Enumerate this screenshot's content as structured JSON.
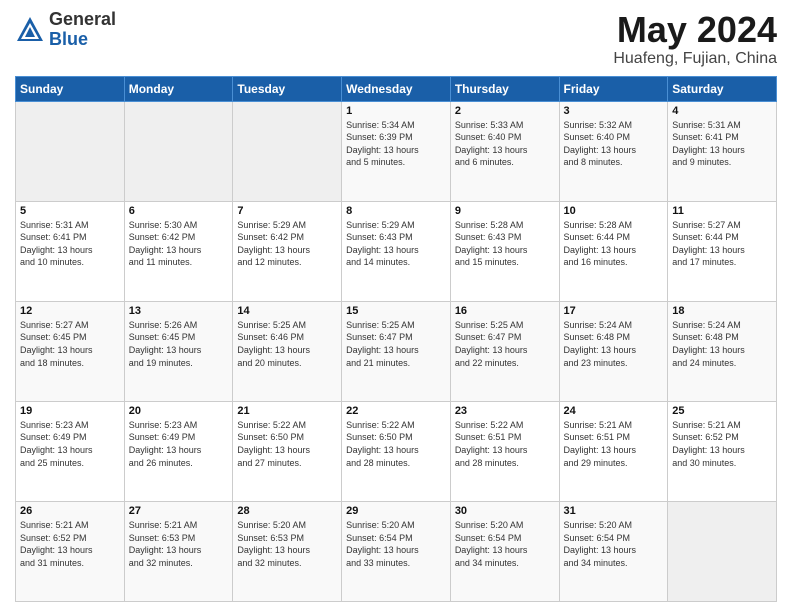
{
  "header": {
    "logo_general": "General",
    "logo_blue": "Blue",
    "title": "May 2024",
    "subtitle": "Huafeng, Fujian, China"
  },
  "weekdays": [
    "Sunday",
    "Monday",
    "Tuesday",
    "Wednesday",
    "Thursday",
    "Friday",
    "Saturday"
  ],
  "weeks": [
    [
      {
        "day": "",
        "info": ""
      },
      {
        "day": "",
        "info": ""
      },
      {
        "day": "",
        "info": ""
      },
      {
        "day": "1",
        "info": "Sunrise: 5:34 AM\nSunset: 6:39 PM\nDaylight: 13 hours\nand 5 minutes."
      },
      {
        "day": "2",
        "info": "Sunrise: 5:33 AM\nSunset: 6:40 PM\nDaylight: 13 hours\nand 6 minutes."
      },
      {
        "day": "3",
        "info": "Sunrise: 5:32 AM\nSunset: 6:40 PM\nDaylight: 13 hours\nand 8 minutes."
      },
      {
        "day": "4",
        "info": "Sunrise: 5:31 AM\nSunset: 6:41 PM\nDaylight: 13 hours\nand 9 minutes."
      }
    ],
    [
      {
        "day": "5",
        "info": "Sunrise: 5:31 AM\nSunset: 6:41 PM\nDaylight: 13 hours\nand 10 minutes."
      },
      {
        "day": "6",
        "info": "Sunrise: 5:30 AM\nSunset: 6:42 PM\nDaylight: 13 hours\nand 11 minutes."
      },
      {
        "day": "7",
        "info": "Sunrise: 5:29 AM\nSunset: 6:42 PM\nDaylight: 13 hours\nand 12 minutes."
      },
      {
        "day": "8",
        "info": "Sunrise: 5:29 AM\nSunset: 6:43 PM\nDaylight: 13 hours\nand 14 minutes."
      },
      {
        "day": "9",
        "info": "Sunrise: 5:28 AM\nSunset: 6:43 PM\nDaylight: 13 hours\nand 15 minutes."
      },
      {
        "day": "10",
        "info": "Sunrise: 5:28 AM\nSunset: 6:44 PM\nDaylight: 13 hours\nand 16 minutes."
      },
      {
        "day": "11",
        "info": "Sunrise: 5:27 AM\nSunset: 6:44 PM\nDaylight: 13 hours\nand 17 minutes."
      }
    ],
    [
      {
        "day": "12",
        "info": "Sunrise: 5:27 AM\nSunset: 6:45 PM\nDaylight: 13 hours\nand 18 minutes."
      },
      {
        "day": "13",
        "info": "Sunrise: 5:26 AM\nSunset: 6:45 PM\nDaylight: 13 hours\nand 19 minutes."
      },
      {
        "day": "14",
        "info": "Sunrise: 5:25 AM\nSunset: 6:46 PM\nDaylight: 13 hours\nand 20 minutes."
      },
      {
        "day": "15",
        "info": "Sunrise: 5:25 AM\nSunset: 6:47 PM\nDaylight: 13 hours\nand 21 minutes."
      },
      {
        "day": "16",
        "info": "Sunrise: 5:25 AM\nSunset: 6:47 PM\nDaylight: 13 hours\nand 22 minutes."
      },
      {
        "day": "17",
        "info": "Sunrise: 5:24 AM\nSunset: 6:48 PM\nDaylight: 13 hours\nand 23 minutes."
      },
      {
        "day": "18",
        "info": "Sunrise: 5:24 AM\nSunset: 6:48 PM\nDaylight: 13 hours\nand 24 minutes."
      }
    ],
    [
      {
        "day": "19",
        "info": "Sunrise: 5:23 AM\nSunset: 6:49 PM\nDaylight: 13 hours\nand 25 minutes."
      },
      {
        "day": "20",
        "info": "Sunrise: 5:23 AM\nSunset: 6:49 PM\nDaylight: 13 hours\nand 26 minutes."
      },
      {
        "day": "21",
        "info": "Sunrise: 5:22 AM\nSunset: 6:50 PM\nDaylight: 13 hours\nand 27 minutes."
      },
      {
        "day": "22",
        "info": "Sunrise: 5:22 AM\nSunset: 6:50 PM\nDaylight: 13 hours\nand 28 minutes."
      },
      {
        "day": "23",
        "info": "Sunrise: 5:22 AM\nSunset: 6:51 PM\nDaylight: 13 hours\nand 28 minutes."
      },
      {
        "day": "24",
        "info": "Sunrise: 5:21 AM\nSunset: 6:51 PM\nDaylight: 13 hours\nand 29 minutes."
      },
      {
        "day": "25",
        "info": "Sunrise: 5:21 AM\nSunset: 6:52 PM\nDaylight: 13 hours\nand 30 minutes."
      }
    ],
    [
      {
        "day": "26",
        "info": "Sunrise: 5:21 AM\nSunset: 6:52 PM\nDaylight: 13 hours\nand 31 minutes."
      },
      {
        "day": "27",
        "info": "Sunrise: 5:21 AM\nSunset: 6:53 PM\nDaylight: 13 hours\nand 32 minutes."
      },
      {
        "day": "28",
        "info": "Sunrise: 5:20 AM\nSunset: 6:53 PM\nDaylight: 13 hours\nand 32 minutes."
      },
      {
        "day": "29",
        "info": "Sunrise: 5:20 AM\nSunset: 6:54 PM\nDaylight: 13 hours\nand 33 minutes."
      },
      {
        "day": "30",
        "info": "Sunrise: 5:20 AM\nSunset: 6:54 PM\nDaylight: 13 hours\nand 34 minutes."
      },
      {
        "day": "31",
        "info": "Sunrise: 5:20 AM\nSunset: 6:54 PM\nDaylight: 13 hours\nand 34 minutes."
      },
      {
        "day": "",
        "info": ""
      }
    ]
  ]
}
